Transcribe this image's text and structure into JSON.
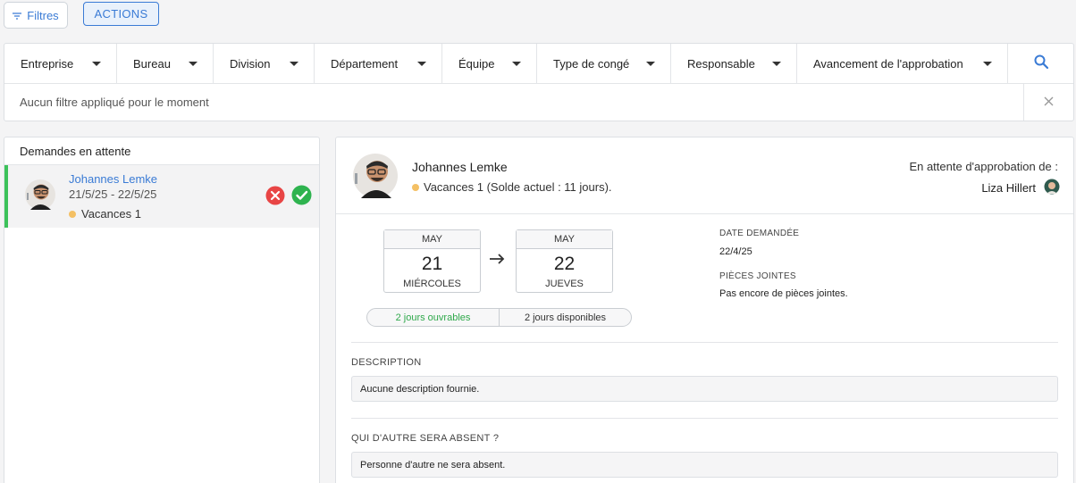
{
  "toolbar": {
    "filters_label": "Filtres",
    "actions_label": "ACTIONS"
  },
  "filters": {
    "dropdowns": [
      {
        "label": "Entreprise"
      },
      {
        "label": "Bureau"
      },
      {
        "label": "Division"
      },
      {
        "label": "Département"
      },
      {
        "label": "Équipe"
      },
      {
        "label": "Type de congé"
      },
      {
        "label": "Responsable"
      },
      {
        "label": "Avancement de l'approbation"
      }
    ],
    "status": "Aucun filtre appliqué pour le moment"
  },
  "pending": {
    "title": "Demandes en attente",
    "items": [
      {
        "name": "Johannes Lemke",
        "dates": "21/5/25 - 22/5/25",
        "type": "Vacances 1"
      }
    ]
  },
  "detail": {
    "name": "Johannes Lemke",
    "type_line": "Vacances 1 (Solde actuel : 11 jours).",
    "awaiting_label": "En attente d'approbation de :",
    "approver": "Liza Hillert",
    "start": {
      "month": "MAY",
      "day": "21",
      "dow": "MIÉRCOLES"
    },
    "end": {
      "month": "MAY",
      "day": "22",
      "dow": "JUEVES"
    },
    "working_days": "2 jours ouvrables",
    "available_days": "2 jours disponibles",
    "date_requested_label": "DATE DEMANDÉE",
    "date_requested": "22/4/25",
    "attachments_label": "PIÈCES JOINTES",
    "attachments": "Pas encore de pièces jointes.",
    "description_label": "DESCRIPTION",
    "description": "Aucune description fournie.",
    "who_else_label": "QUI D'AUTRE SERA ABSENT ?",
    "who_else": "Personne d'autre ne sera absent."
  },
  "colors": {
    "accent": "#3a7bd5",
    "approve": "#2eb34f",
    "reject": "#e84545",
    "leave_type_dot": "#f4c064",
    "selected_bar": "#3cc25a"
  }
}
